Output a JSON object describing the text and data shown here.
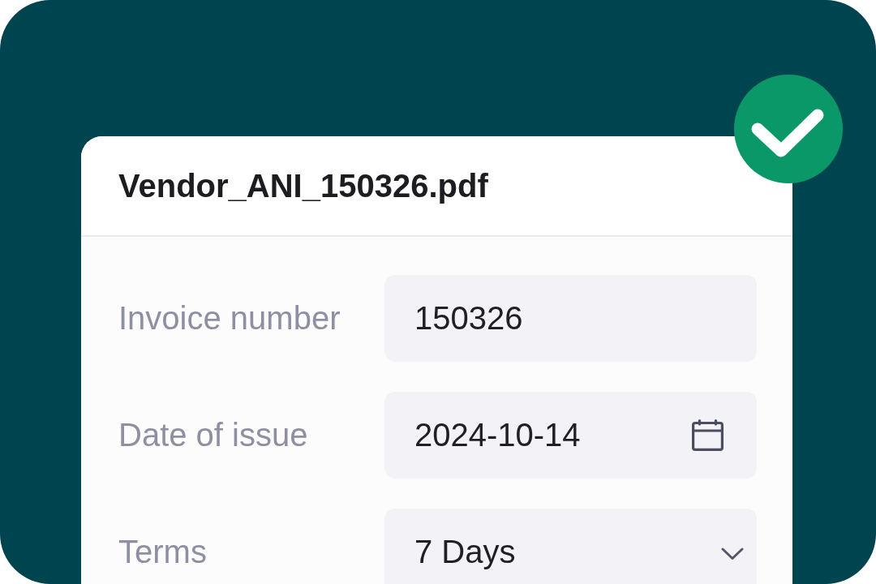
{
  "file": {
    "name": "Vendor_ANI_150326.pdf",
    "verified": true
  },
  "fields": [
    {
      "label": "Invoice number",
      "kind": "text",
      "value": "150326"
    },
    {
      "label": "Date of issue",
      "kind": "date",
      "value": "2024-10-14"
    },
    {
      "label": "Terms",
      "kind": "select",
      "value": "7 Days"
    }
  ]
}
